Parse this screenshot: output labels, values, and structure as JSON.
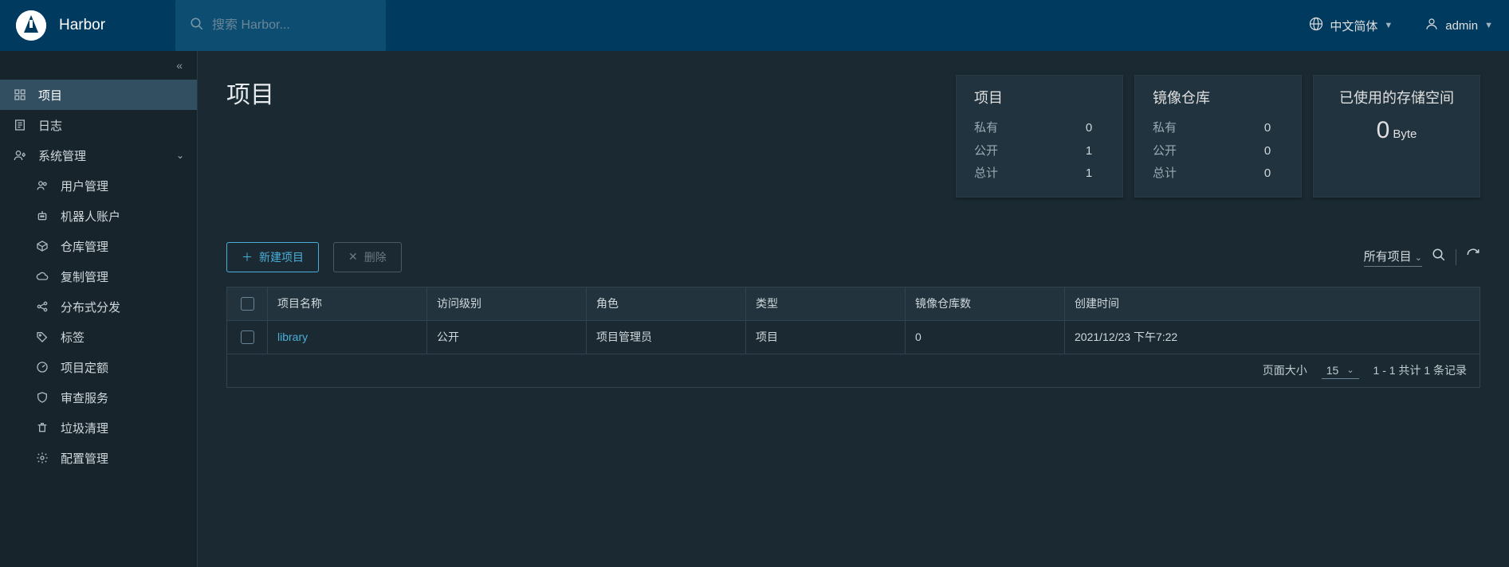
{
  "header": {
    "app_name": "Harbor",
    "search_placeholder": "搜索 Harbor...",
    "language": "中文简体",
    "user": "admin"
  },
  "sidebar": {
    "items": [
      {
        "label": "项目"
      },
      {
        "label": "日志"
      },
      {
        "label": "系统管理"
      }
    ],
    "admin_children": [
      {
        "label": "用户管理"
      },
      {
        "label": "机器人账户"
      },
      {
        "label": "仓库管理"
      },
      {
        "label": "复制管理"
      },
      {
        "label": "分布式分发"
      },
      {
        "label": "标签"
      },
      {
        "label": "项目定额"
      },
      {
        "label": "审查服务"
      },
      {
        "label": "垃圾清理"
      },
      {
        "label": "配置管理"
      }
    ]
  },
  "page": {
    "title": "项目",
    "new_button": "新建项目",
    "delete_button": "删除",
    "filter_label": "所有项目"
  },
  "stats": {
    "projects": {
      "title": "项目",
      "private_label": "私有",
      "private_value": "0",
      "public_label": "公开",
      "public_value": "1",
      "total_label": "总计",
      "total_value": "1"
    },
    "repos": {
      "title": "镜像仓库",
      "private_label": "私有",
      "private_value": "0",
      "public_label": "公开",
      "public_value": "0",
      "total_label": "总计",
      "total_value": "0"
    },
    "storage": {
      "title": "已使用的存储空间",
      "value": "0",
      "unit": "Byte"
    }
  },
  "table": {
    "columns": {
      "name": "项目名称",
      "access": "访问级别",
      "role": "角色",
      "type": "类型",
      "repo_count": "镜像仓库数",
      "created": "创建时间"
    },
    "rows": [
      {
        "name": "library",
        "access": "公开",
        "role": "项目管理员",
        "type": "项目",
        "repo_count": "0",
        "created": "2021/12/23 下午7:22"
      }
    ],
    "footer": {
      "page_size_label": "页面大小",
      "page_size_value": "15",
      "range": "1 - 1 共计 1 条记录"
    }
  }
}
